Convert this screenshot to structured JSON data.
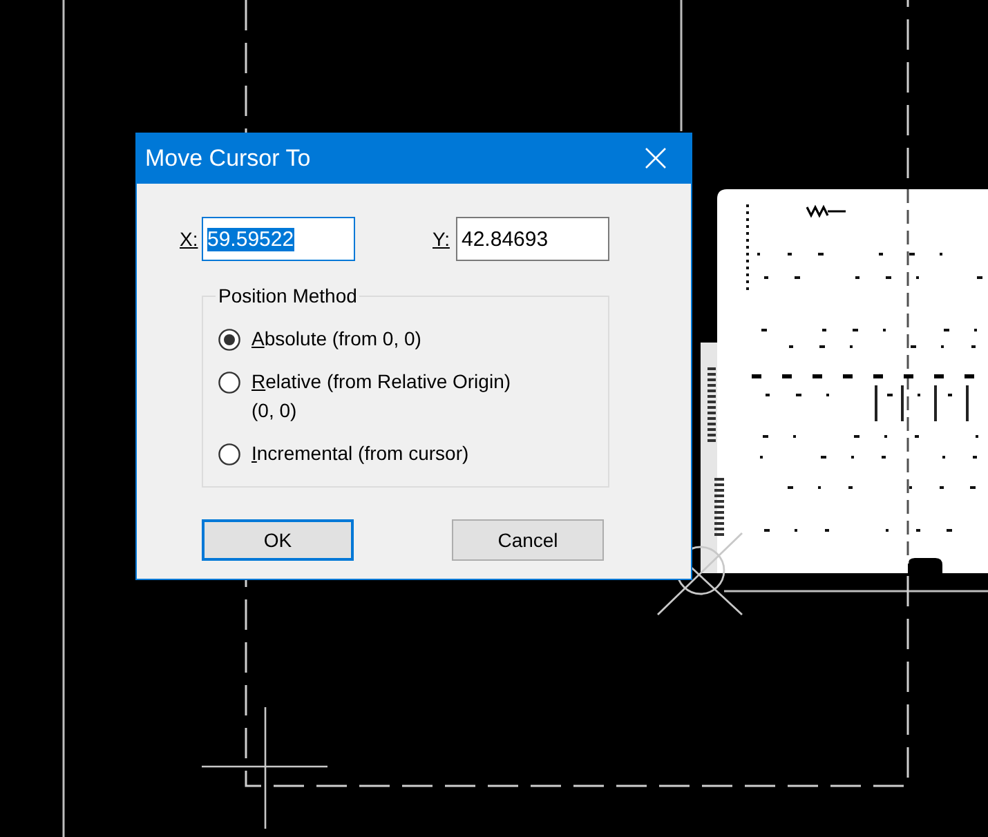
{
  "dialog": {
    "title": "Move Cursor To",
    "fields": [
      {
        "label": "X:",
        "underlined_access_key": true,
        "value": "59.59522",
        "focused": true
      },
      {
        "label": "Y:",
        "underlined_access_key": true,
        "value": "42.84693",
        "focused": false
      }
    ],
    "position_method": {
      "title": "Position Method",
      "options": [
        {
          "label": "Absolute (from 0, 0)",
          "underlined_access_key": true,
          "selected": true
        },
        {
          "label": "Relative (from Relative Origin)\n(0, 0)",
          "underlined_access_key": true,
          "selected": false
        },
        {
          "label": "Incremental (from cursor)",
          "underlined_access_key": true,
          "selected": false
        }
      ]
    },
    "buttons": [
      {
        "label": "OK",
        "default": true
      },
      {
        "label": "Cancel",
        "default": false
      }
    ]
  }
}
